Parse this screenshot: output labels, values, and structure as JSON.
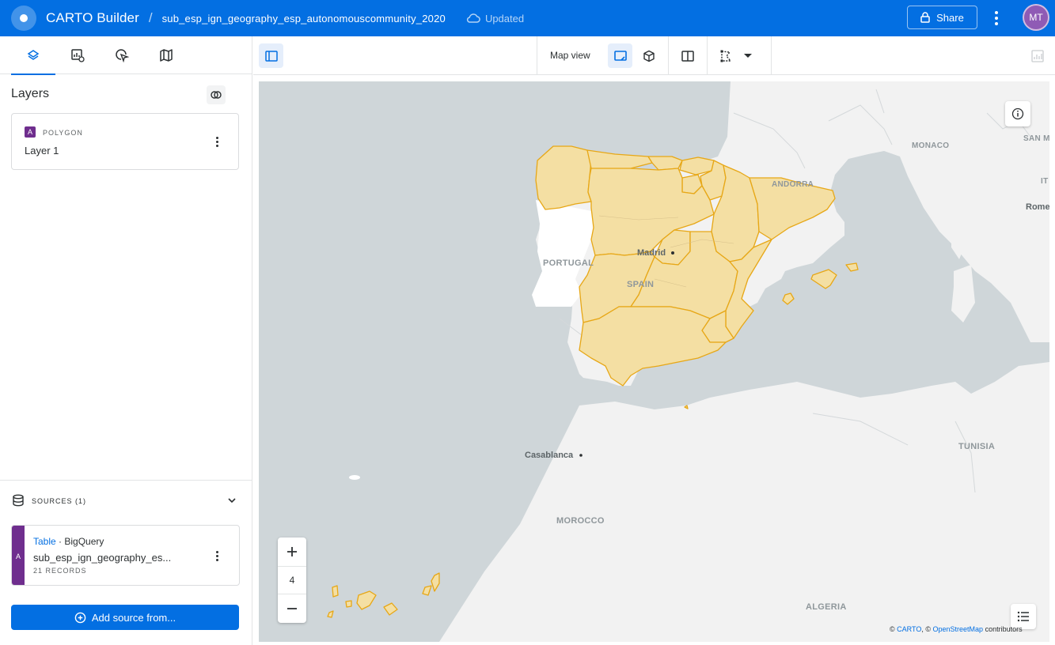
{
  "header": {
    "app_title": "CARTO Builder",
    "separator": "/",
    "map_name": "sub_esp_ign_geography_esp_autonomouscommunity_2020",
    "status": "Updated",
    "share_label": "Share",
    "avatar_initials": "MT",
    "brand_color": "#036fe2"
  },
  "left_panel": {
    "tabs": [
      {
        "icon": "layers-icon"
      },
      {
        "icon": "widgets-icon"
      },
      {
        "icon": "interactions-icon"
      },
      {
        "icon": "basemap-icon"
      }
    ],
    "layers_title": "Layers",
    "layers": [
      {
        "badge": "A",
        "type": "POLYGON",
        "name": "Layer 1"
      }
    ],
    "sources": {
      "label": "SOURCES (1)",
      "items": [
        {
          "badge": "A",
          "type": "Table",
          "connector": "BigQuery",
          "name": "sub_esp_ign_geography_es...",
          "records": "21 RECORDS"
        }
      ]
    },
    "add_source_label": "Add source from..."
  },
  "toolbar": {
    "map_view_label": "Map view"
  },
  "map": {
    "zoom_level": "4",
    "labels": {
      "portugal": "PORTUGAL",
      "spain": "SPAIN",
      "madrid": "Madrid",
      "andorra": "ANDORRA",
      "monaco": "MONACO",
      "san_marino": "SAN M",
      "italy": "IT",
      "rome": "Rome",
      "tunisia": "TUNISIA",
      "morocco": "MOROCCO",
      "algeria": "ALGERIA",
      "casablanca": "Casablanca"
    },
    "attribution": {
      "prefix": "©",
      "carto": "CARTO",
      "mid": ", ©",
      "osm": "OpenStreetMap",
      "suffix": "contributors"
    },
    "fill_color": "#f4dfa3",
    "stroke_color": "#e7a716"
  }
}
